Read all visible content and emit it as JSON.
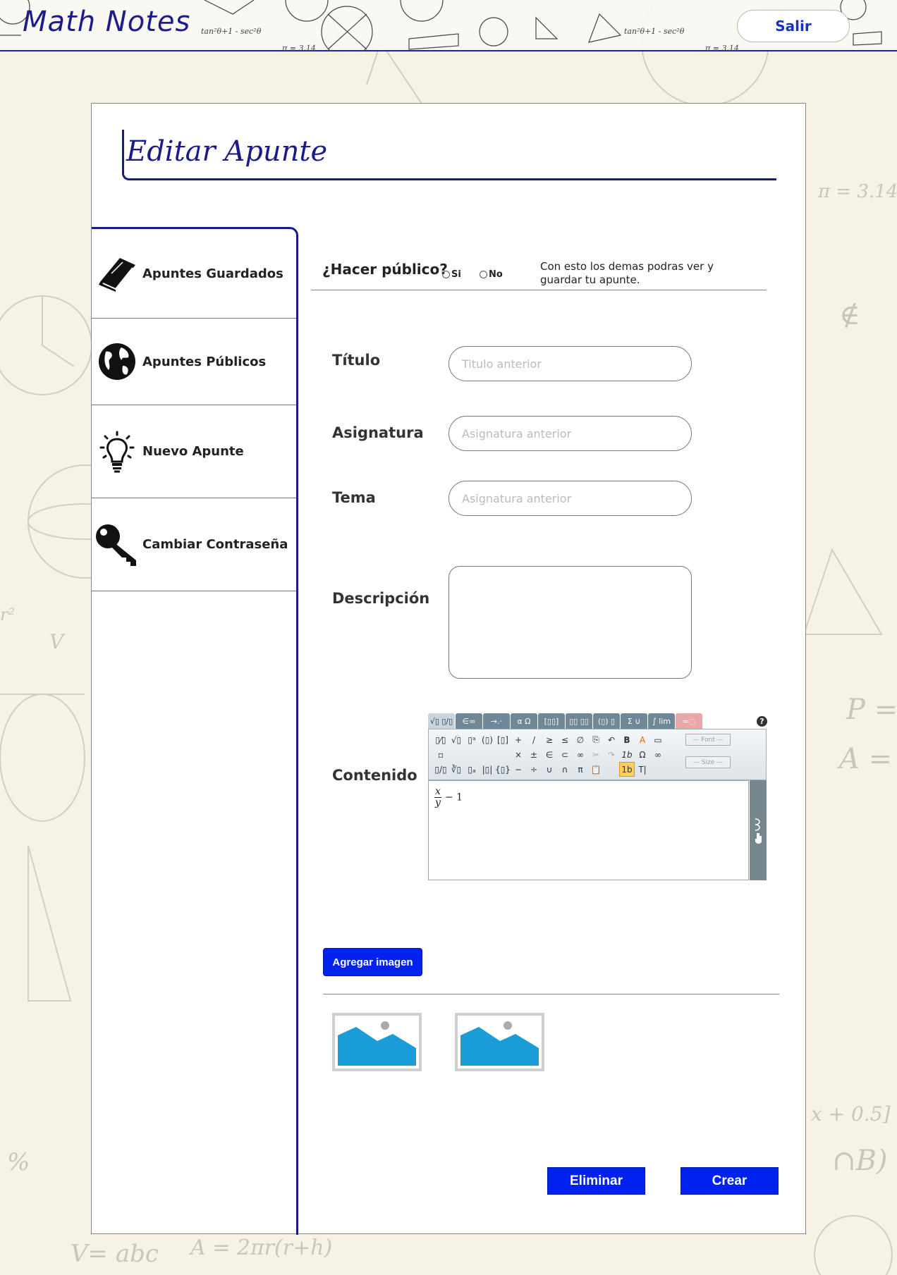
{
  "header": {
    "app_title": "Math Notes",
    "logout_label": "Salir",
    "doodle_formula": "tan²θ+1 - sec²θ",
    "doodle_pi": "π = 3.14"
  },
  "page": {
    "title": "Editar Apunte"
  },
  "sidebar": {
    "items": [
      {
        "label": "Apuntes Guardados",
        "icon": "book-icon"
      },
      {
        "label": "Apuntes Públicos",
        "icon": "globe-icon"
      },
      {
        "label": "Nuevo Apunte",
        "icon": "lightbulb-icon"
      },
      {
        "label": "Cambiar Contraseña",
        "icon": "key-icon"
      }
    ]
  },
  "form": {
    "public": {
      "question": "¿Hacer público?",
      "yes_label": "Si",
      "no_label": "No",
      "note": "Con esto los demas podras ver y guardar  tu apunte."
    },
    "title_label": "Título",
    "title_placeholder": "Titulo anterior",
    "subject_label": "Asignatura",
    "subject_placeholder": "Asignatura anterior",
    "topic_label": "Tema",
    "topic_placeholder": "Asignatura anterior",
    "description_label": "Descripción",
    "content_label": "Contenido",
    "content_equation": {
      "numerator": "x",
      "denominator": "y",
      "rest": "− 1"
    },
    "add_image_label": "Agregar imagen",
    "delete_label": "Eliminar",
    "create_label": "Crear"
  },
  "equation_toolbar": {
    "tabs": [
      "√▯ ▯/▯",
      "∈∞",
      "→.·",
      "α Ω",
      "[▯▯]",
      "▯▯ ▯▯",
      "(▯) ▯",
      "Σ ∪",
      "∫ lim",
      "≈◌"
    ],
    "font_select": "— Font —",
    "size_select": "— Size —"
  },
  "colors": {
    "accent": "#1a1a8c",
    "button_blue": "#0022ee",
    "link_blue": "#1b33c2",
    "image_blue": "#1a9cd8"
  }
}
